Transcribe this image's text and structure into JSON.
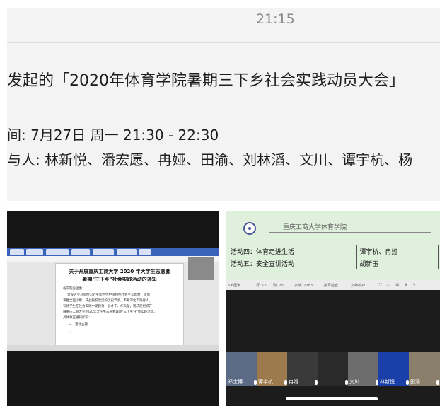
{
  "status": {
    "time": "21:15"
  },
  "meeting": {
    "title": "发起的「2020年体育学院暑期三下乡社会实践动员大会」",
    "time_row": "间: 7月27日 周一 21:30 - 22:30",
    "participants_row": "与人: 林新悦、潘宏愿、冉娅、田渝、刘林滔、文川、谭宇杭、杨"
  },
  "left_doc": {
    "title_line1": "关于开展重庆工商大学 2020 年大学生志愿者",
    "title_line2": "暑期\"三下乡\"社会实践活动的通知",
    "salutation": "各学院分团委：",
    "para_line1": "为深入学习贯彻习近平新时代中国特色社会主义思想，贯彻",
    "para_line2": "决胜全面小康、决战脱贫攻坚的历史节点，不断深化实践育人，",
    "para_line3": "引领学生在社会实践中受教育、长才干、作贡献，现决定组织开",
    "para_line4": "展重庆工商大学2020年大学生志愿者暑期\"三下乡\"社会实践活动。",
    "para_line5": "具体事宜通知如下：",
    "section_heading": "一、活动主题",
    "truncated_line": "..."
  },
  "right_doc": {
    "university": "重庆工商大学体育学院",
    "rows": [
      {
        "activity": "活动四：体育走进生活",
        "people": "谭宇杭、冉娅"
      },
      {
        "activity": "活动五：安全宣讲活动",
        "people": "胡新玉"
      }
    ],
    "status_bar": {
      "zoom": "5.6厘米",
      "row": "行: 12",
      "col": "列: 20",
      "word_count": "字数: 2283",
      "spellcheck": "拼写检查",
      "doc_check": "文档校对"
    }
  },
  "gallery": [
    {
      "name": "郑士博",
      "bg": "#5b6a85"
    },
    {
      "name": "谭宇杭",
      "bg": "#9c7a4e"
    },
    {
      "name": "冉娅",
      "bg": "#3a3a3a"
    },
    {
      "name": "",
      "bg": "#2a2a2a"
    },
    {
      "name": "文川",
      "bg": "#6d6d6d"
    },
    {
      "name": "林新悦",
      "bg": "#1a3fa8"
    },
    {
      "name": "田渝",
      "bg": "#8a7f6a"
    }
  ]
}
